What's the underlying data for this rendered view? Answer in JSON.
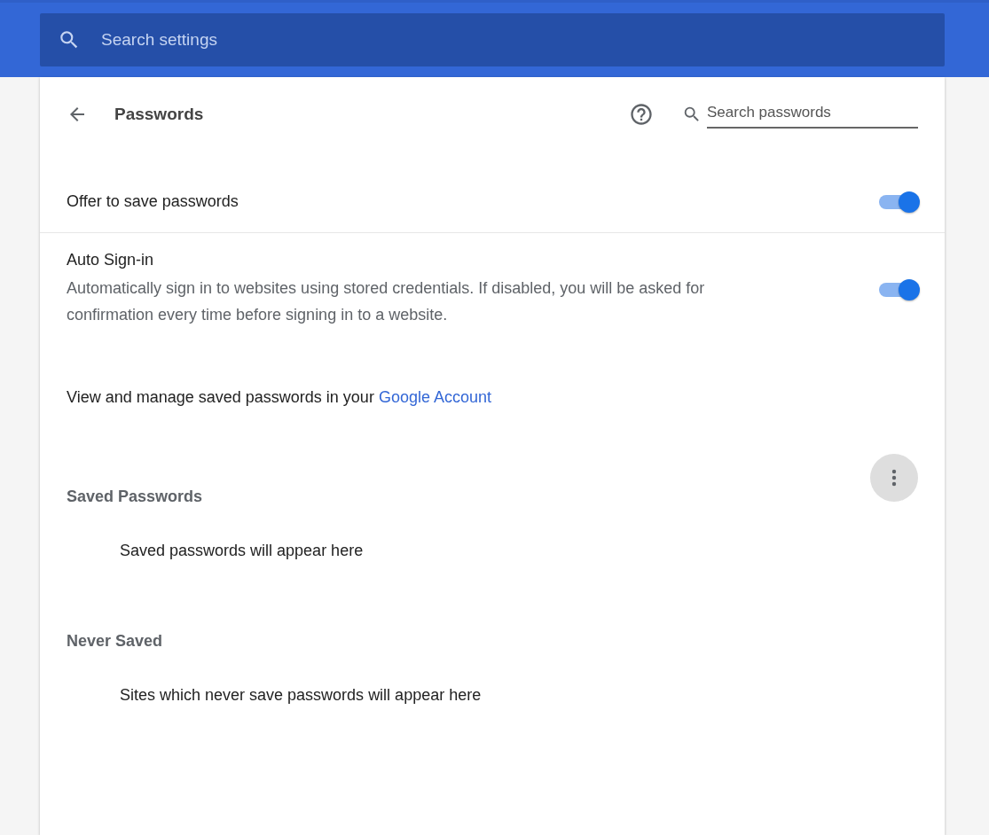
{
  "search_settings": {
    "placeholder": "Search settings"
  },
  "page": {
    "title": "Passwords",
    "search": {
      "placeholder": "Search passwords"
    }
  },
  "settings": [
    {
      "kind": "toggle",
      "label": "Offer to save passwords",
      "on": true
    },
    {
      "kind": "toggle",
      "label": "Auto Sign-in",
      "description": "Automatically sign in to websites using stored credentials. If disabled, you will be asked for confirmation every time before signing in to a website.",
      "on": true
    },
    {
      "kind": "link_text",
      "text": "View and manage saved passwords in your",
      "link": "Google Account"
    }
  ],
  "sections": [
    {
      "title": "Saved Passwords",
      "empty_text": "Saved passwords will appear here",
      "has_menu": true
    },
    {
      "title": "Never Saved",
      "empty_text": "Sites which never save passwords will appear here",
      "has_menu": false
    }
  ]
}
